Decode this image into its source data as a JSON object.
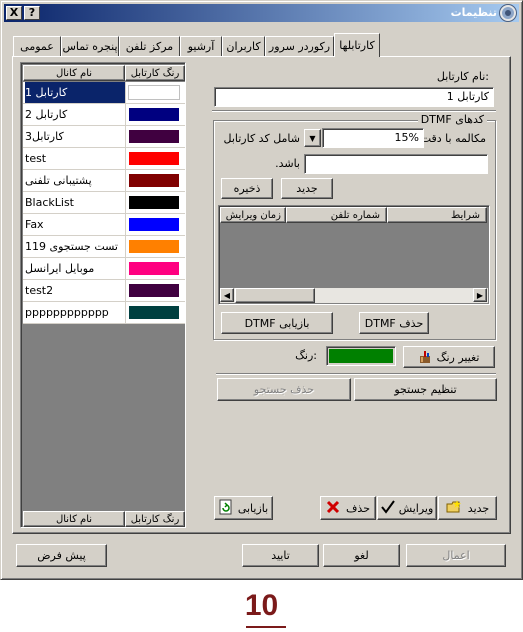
{
  "window": {
    "title": "تنظیمات",
    "help_btn": "?",
    "close_btn": "X"
  },
  "tabs": [
    {
      "label": "کارتابلها",
      "active": true
    },
    {
      "label": "رکوردر سرور"
    },
    {
      "label": "کاربران"
    },
    {
      "label": "آرشیو"
    },
    {
      "label": "مرکز تلفن"
    },
    {
      "label": "پنجره تماس"
    },
    {
      "label": "عمومی"
    }
  ],
  "list": {
    "col_color": "رنگ کارتابل",
    "col_name": "نام کانال",
    "rows": [
      {
        "name": "کارتابل 1",
        "color": "#ffffff",
        "selected": true
      },
      {
        "name": "کارتابل 2",
        "color": "#000080"
      },
      {
        "name": "کارتابل3",
        "color": "#400040"
      },
      {
        "name": "test",
        "color": "#ff0000"
      },
      {
        "name": "پشتیبانی تلفنی",
        "color": "#800000"
      },
      {
        "name": "BlackList",
        "color": "#000000"
      },
      {
        "name": "Fax",
        "color": "#0000ff"
      },
      {
        "name": "تست جستجوی 119",
        "color": "#ff8000"
      },
      {
        "name": "موبایل ایرانسل",
        "color": "#ff0080"
      },
      {
        "name": "test2",
        "color": "#400040"
      },
      {
        "name": "pppppppppppp",
        "color": "#004040"
      }
    ]
  },
  "form": {
    "name_label": ":نام کارتابل",
    "name_value": "کارتابل 1",
    "dtmf_group": "کدهای DTMF",
    "accuracy_label": "مکالمه با دقت",
    "accuracy_value": "15%",
    "contains_label": "شامل کد کارتابل",
    "be_label": "باشد.",
    "btn_new": "جدید",
    "btn_save": "ذخیره",
    "grid_cols": [
      "شرایط",
      "شماره تلفن",
      "زمان ویرایش"
    ],
    "btn_delete_dtmf": "حذف DTMF",
    "btn_refresh_dtmf": "بازیابی DTMF",
    "color_label": ":رنگ",
    "color_value": "#008000",
    "btn_change_color": "تغییر رنگ",
    "btn_set_search": "تنظیم جستجو",
    "btn_delete_search": "حذف جستجو"
  },
  "actions": {
    "btn_new": "جدید",
    "btn_edit": "ویرایش",
    "btn_delete": "حذف",
    "btn_refresh": "بازیابی"
  },
  "footer": {
    "btn_apply": "اعمال",
    "btn_cancel": "لغو",
    "btn_ok": "تایید",
    "btn_default": "پیش فرض"
  },
  "page_number": "10"
}
